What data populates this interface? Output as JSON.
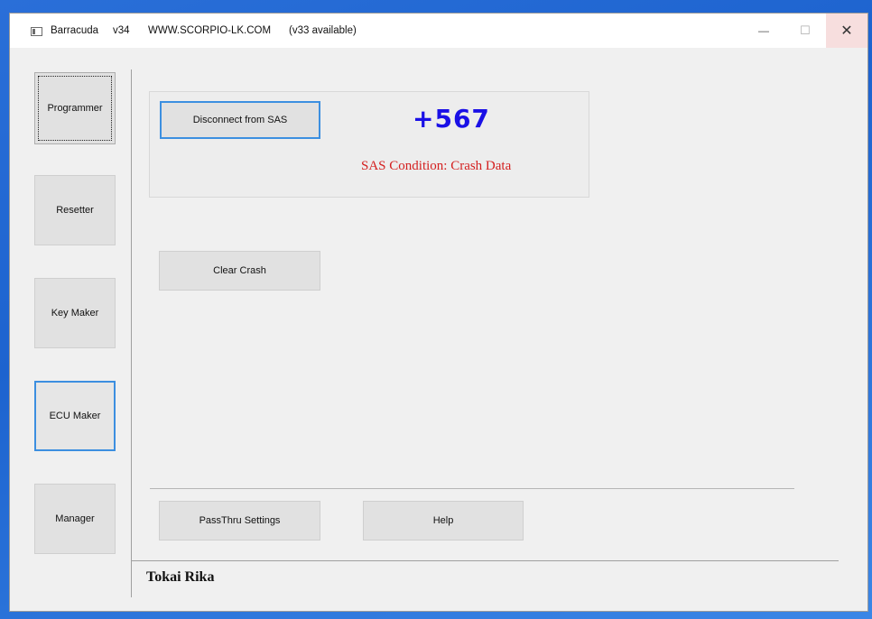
{
  "window": {
    "app_name": "Barracuda",
    "version": "v34",
    "website": "WWW.SCORPIO-LK.COM",
    "update_notice": "(v33 available)",
    "controls": {
      "minimize": "—",
      "maximize": "☐",
      "close": "✕"
    }
  },
  "sidebar": {
    "items": [
      {
        "label": "Programmer"
      },
      {
        "label": "Resetter"
      },
      {
        "label": "Key Maker"
      },
      {
        "label": "ECU Maker"
      },
      {
        "label": "Manager"
      }
    ]
  },
  "main": {
    "disconnect_label": "Disconnect from SAS",
    "angle_value": "+567",
    "sas_condition": "SAS Condition: Crash Data",
    "clear_crash_label": "Clear Crash",
    "passthru_label": "PassThru Settings",
    "help_label": "Help",
    "footer_label": "Tokai Rika"
  }
}
